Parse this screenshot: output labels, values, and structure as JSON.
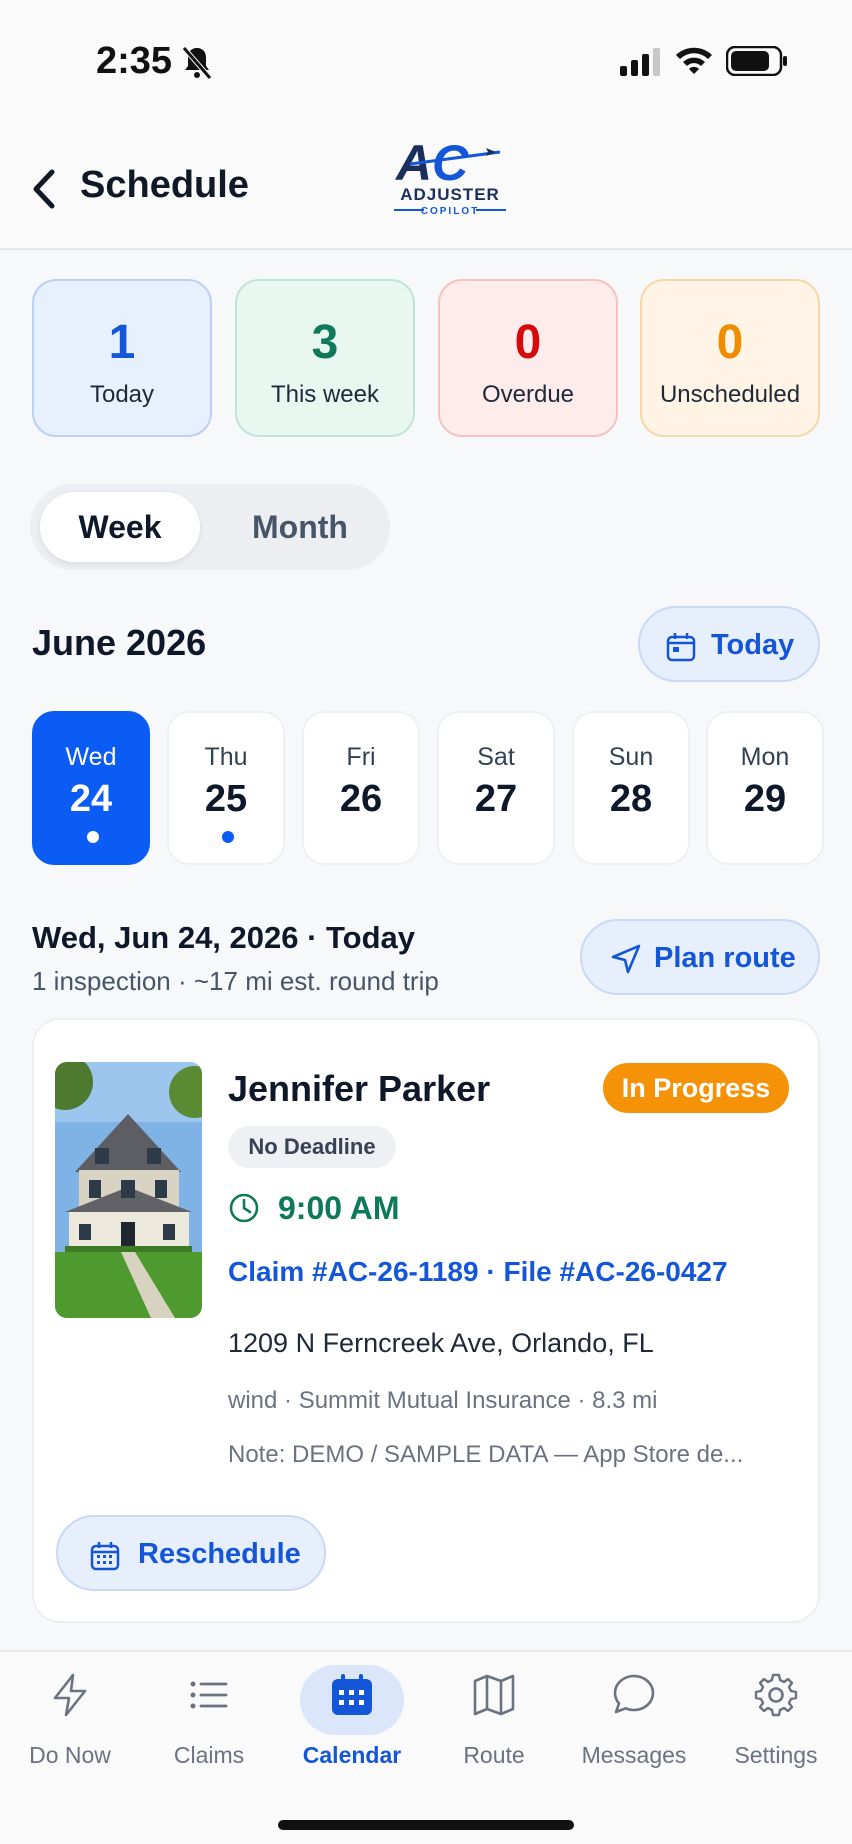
{
  "status_bar": {
    "time": "2:35"
  },
  "header": {
    "title": "Schedule",
    "logo_text": "ADJUSTER",
    "logo_sub": "COPILOT",
    "logo_mark": "AC"
  },
  "stats": [
    {
      "value": "1",
      "label": "Today",
      "color": "#1456d8",
      "bg": "#e8f0fd",
      "border": "#bcd0f5"
    },
    {
      "value": "3",
      "label": "This week",
      "color": "#0f7a5a",
      "bg": "#e9f7f1",
      "border": "#bfe6d5"
    },
    {
      "value": "0",
      "label": "Overdue",
      "color": "#d40b0b",
      "bg": "#fdeceb",
      "border": "#f4c3c0"
    },
    {
      "value": "0",
      "label": "Unscheduled",
      "color": "#f08c00",
      "bg": "#fff4e6",
      "border": "#f7d7a8"
    }
  ],
  "view_toggle": {
    "week": "Week",
    "month": "Month",
    "selected": "Week"
  },
  "calendar": {
    "month_label": "June 2026",
    "today_button": "Today",
    "days": [
      {
        "name": "Wed",
        "date": "24",
        "selected": true,
        "has_event": true
      },
      {
        "name": "Thu",
        "date": "25",
        "selected": false,
        "has_event": true
      },
      {
        "name": "Fri",
        "date": "26",
        "selected": false,
        "has_event": false
      },
      {
        "name": "Sat",
        "date": "27",
        "selected": false,
        "has_event": false
      },
      {
        "name": "Sun",
        "date": "28",
        "selected": false,
        "has_event": false
      },
      {
        "name": "Mon",
        "date": "29",
        "selected": false,
        "has_event": false
      }
    ]
  },
  "day_summary": {
    "title": "Wed, Jun 24, 2026 · Today",
    "subtitle": "1 inspection · ~17 mi est. round trip",
    "plan_route": "Plan route"
  },
  "inspection": {
    "name": "Jennifer Parker",
    "status": "In Progress",
    "deadline": "No Deadline",
    "time": "9:00 AM",
    "claim": "Claim #AC-26-1189 · File #AC-26-0427",
    "address": "1209 N Ferncreek Ave, Orlando, FL",
    "meta": "wind  · Summit Mutual Insurance  · 8.3 mi",
    "note": "Note: DEMO / SAMPLE DATA — App Store de...",
    "reschedule": "Reschedule"
  },
  "tabs": [
    {
      "label": "Do Now",
      "icon": "bolt-icon"
    },
    {
      "label": "Claims",
      "icon": "list-icon"
    },
    {
      "label": "Calendar",
      "icon": "calendar-icon",
      "active": true
    },
    {
      "label": "Route",
      "icon": "map-icon"
    },
    {
      "label": "Messages",
      "icon": "chat-icon"
    },
    {
      "label": "Settings",
      "icon": "gear-icon"
    }
  ]
}
